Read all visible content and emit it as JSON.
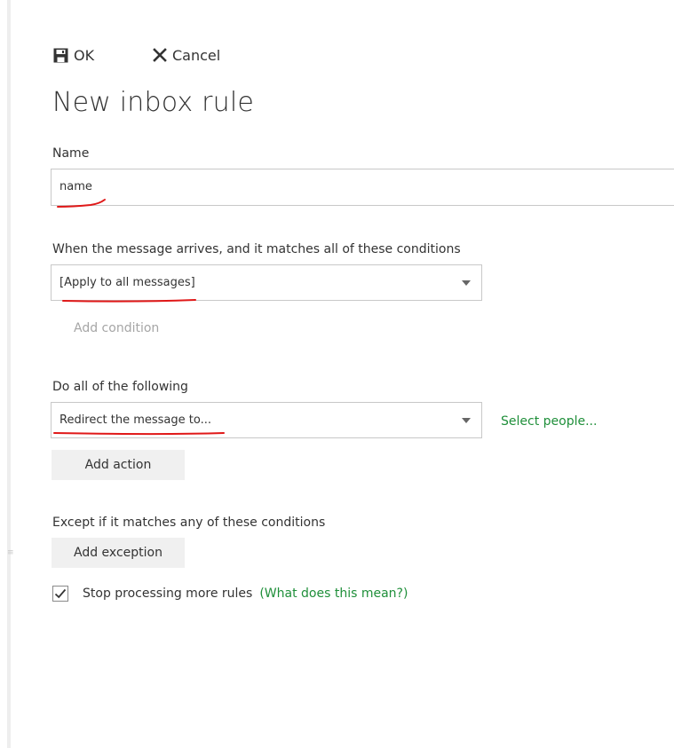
{
  "commands": {
    "ok_label": "OK",
    "cancel_label": "Cancel"
  },
  "page_title": "New inbox rule",
  "name_field": {
    "label": "Name",
    "value": "name"
  },
  "conditions": {
    "label": "When the message arrives, and it matches all of these conditions",
    "selected": "[Apply to all messages]",
    "add_label": "Add condition"
  },
  "actions": {
    "label": "Do all of the following",
    "selected": "Redirect the message to...",
    "select_people_label": "Select people...",
    "add_label": "Add action"
  },
  "exceptions": {
    "label": "Except if it matches any of these conditions",
    "add_label": "Add exception"
  },
  "stop_processing": {
    "checked": true,
    "label": "Stop processing more rules",
    "help_link": "What does this mean?"
  },
  "colors": {
    "link_green": "#1f8f3a",
    "annotation_red": "#e01818"
  },
  "icons": {
    "ok": "save-icon",
    "cancel": "close-icon",
    "dropdown": "chevron-down-icon",
    "check": "checkmark-icon"
  }
}
